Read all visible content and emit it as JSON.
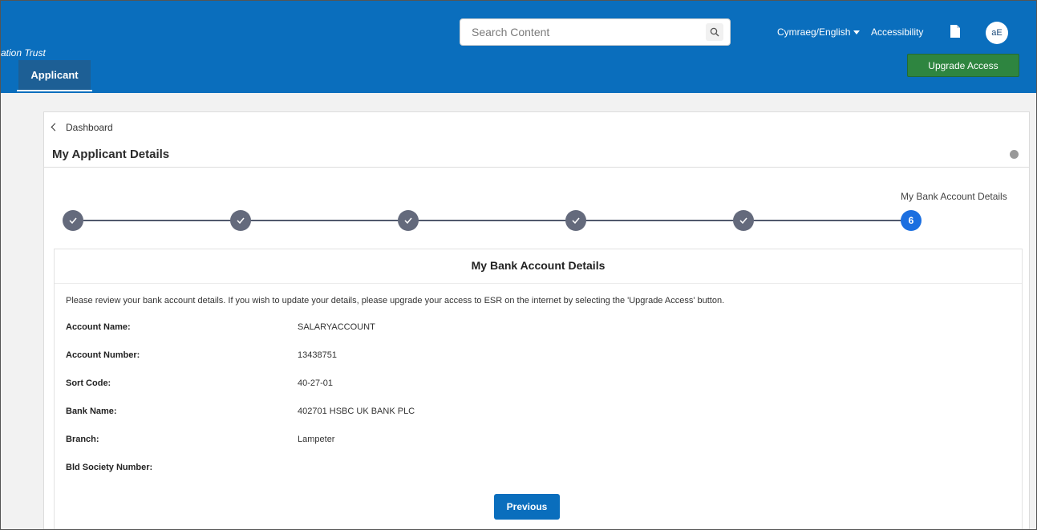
{
  "header": {
    "org_name_fragment": "ation Trust",
    "tab_label": "Applicant",
    "search_placeholder": "Search Content",
    "language_label": "Cymraeg/English",
    "accessibility_label": "Accessibility",
    "avatar_initials": "aE",
    "upgrade_label": "Upgrade Access",
    "colors": {
      "header_bg": "#0a6ebd",
      "upgrade_bg": "#2e8540"
    }
  },
  "breadcrumb": {
    "back_label": "Dashboard"
  },
  "page": {
    "title": "My Applicant Details"
  },
  "stepper": {
    "current_step_label": "My Bank Account Details",
    "current_step_number": "6",
    "steps": [
      {
        "state": "complete",
        "icon": "check-icon"
      },
      {
        "state": "complete",
        "icon": "check-icon"
      },
      {
        "state": "complete",
        "icon": "check-icon"
      },
      {
        "state": "complete",
        "icon": "check-icon"
      },
      {
        "state": "complete",
        "icon": "check-icon"
      },
      {
        "state": "current",
        "number": "6"
      }
    ]
  },
  "bank_details": {
    "title": "My Bank Account Details",
    "intro": "Please review your bank account details. If you wish to update your details, please upgrade your access to ESR on the internet by selecting the 'Upgrade Access' button.",
    "fields": [
      {
        "label": "Account Name:",
        "value": "SALARYACCOUNT"
      },
      {
        "label": "Account Number:",
        "value": "13438751"
      },
      {
        "label": "Sort Code:",
        "value": "40-27-01"
      },
      {
        "label": "Bank Name:",
        "value": "402701 HSBC UK BANK PLC"
      },
      {
        "label": "Branch:",
        "value": "Lampeter"
      },
      {
        "label": "Bld Society Number:",
        "value": ""
      }
    ],
    "previous_label": "Previous"
  }
}
